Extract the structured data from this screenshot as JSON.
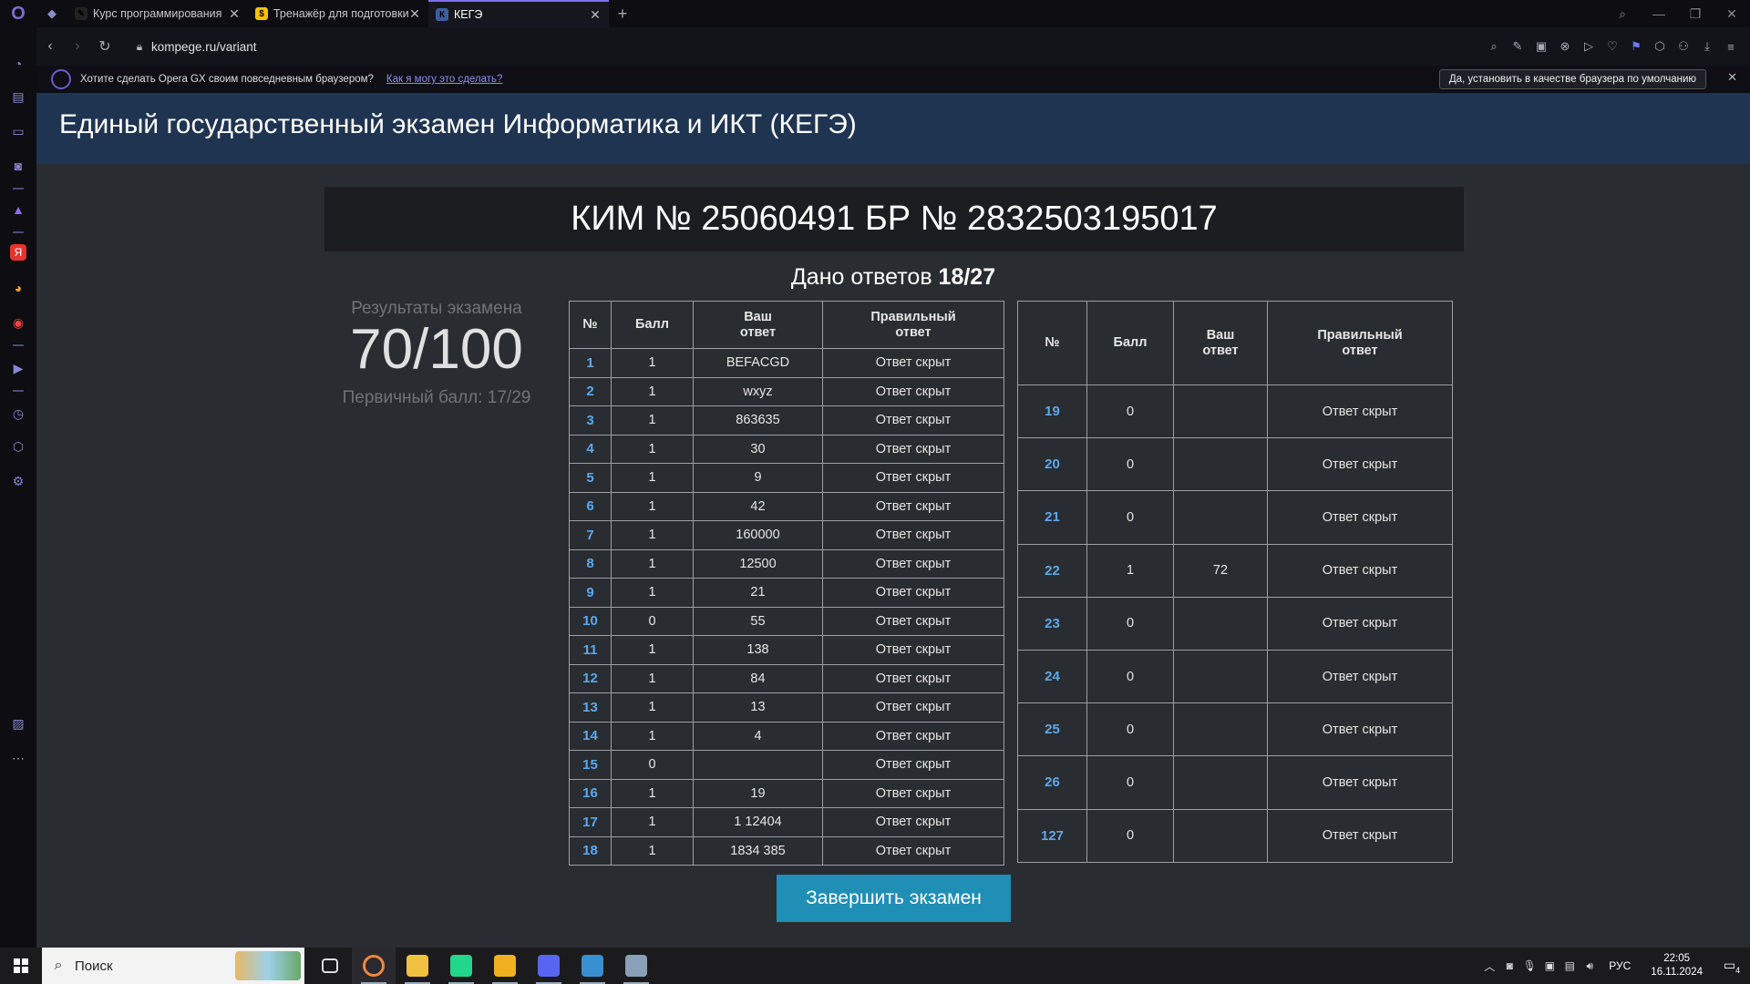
{
  "browser": {
    "tabs": [
      {
        "title": "Курс программирования",
        "active": false,
        "fav_color": "#222222",
        "fav_glyph": "✎"
      },
      {
        "title": "Тренажёр для подготовки",
        "active": false,
        "fav_color": "#f2c200",
        "fav_glyph": "$"
      },
      {
        "title": "КЕГЭ",
        "active": true,
        "fav_color": "#3a5fa0",
        "fav_glyph": "К"
      }
    ],
    "url": "kompege.ru/variant",
    "notification": {
      "question": "Хотите сделать Opera GX своим повседневным браузером?",
      "link": "Как я могу это сделать?",
      "button": "Да, установить в качестве браузера по умолчанию"
    }
  },
  "page": {
    "header_title": "Единый государственный экзамен Информатика и ИКТ (КЕГЭ)",
    "kim_title": "КИМ № 25060491 БР № 2832503195017",
    "answers_label": "Дано ответов ",
    "answers_value": "18/27",
    "results_label": "Результаты экзамена",
    "score": "70/100",
    "primary_score": "Первичный балл: 17/29",
    "finish_button": "Завершить экзамен"
  },
  "table_headers": {
    "num": "№",
    "score": "Балл",
    "your_answer_1": "Ваш",
    "your_answer_2": "ответ",
    "correct_1": "Правильный",
    "correct_2": "ответ"
  },
  "table_left": [
    {
      "n": "1",
      "score": "1",
      "answer": "BEFACGD",
      "correct": "Ответ скрыт"
    },
    {
      "n": "2",
      "score": "1",
      "answer": "wxyz",
      "correct": "Ответ скрыт"
    },
    {
      "n": "3",
      "score": "1",
      "answer": "863635",
      "correct": "Ответ скрыт"
    },
    {
      "n": "4",
      "score": "1",
      "answer": "30",
      "correct": "Ответ скрыт"
    },
    {
      "n": "5",
      "score": "1",
      "answer": "9",
      "correct": "Ответ скрыт"
    },
    {
      "n": "6",
      "score": "1",
      "answer": "42",
      "correct": "Ответ скрыт"
    },
    {
      "n": "7",
      "score": "1",
      "answer": "160000",
      "correct": "Ответ скрыт"
    },
    {
      "n": "8",
      "score": "1",
      "answer": "12500",
      "correct": "Ответ скрыт"
    },
    {
      "n": "9",
      "score": "1",
      "answer": "21",
      "correct": "Ответ скрыт"
    },
    {
      "n": "10",
      "score": "0",
      "answer": "55",
      "correct": "Ответ скрыт"
    },
    {
      "n": "11",
      "score": "1",
      "answer": "138",
      "correct": "Ответ скрыт"
    },
    {
      "n": "12",
      "score": "1",
      "answer": "84",
      "correct": "Ответ скрыт"
    },
    {
      "n": "13",
      "score": "1",
      "answer": "13",
      "correct": "Ответ скрыт"
    },
    {
      "n": "14",
      "score": "1",
      "answer": "4",
      "correct": "Ответ скрыт"
    },
    {
      "n": "15",
      "score": "0",
      "answer": "",
      "correct": "Ответ скрыт"
    },
    {
      "n": "16",
      "score": "1",
      "answer": "19",
      "correct": "Ответ скрыт"
    },
    {
      "n": "17",
      "score": "1",
      "answer": "1 12404",
      "correct": "Ответ скрыт"
    },
    {
      "n": "18",
      "score": "1",
      "answer": "1834 385",
      "correct": "Ответ скрыт"
    }
  ],
  "table_right": [
    {
      "n": "19",
      "score": "0",
      "answer": "",
      "correct": "Ответ скрыт"
    },
    {
      "n": "20",
      "score": "0",
      "answer": "",
      "correct": "Ответ скрыт"
    },
    {
      "n": "21",
      "score": "0",
      "answer": "",
      "correct": "Ответ скрыт"
    },
    {
      "n": "22",
      "score": "1",
      "answer": "72",
      "correct": "Ответ скрыт"
    },
    {
      "n": "23",
      "score": "0",
      "answer": "",
      "correct": "Ответ скрыт"
    },
    {
      "n": "24",
      "score": "0",
      "answer": "",
      "correct": "Ответ скрыт"
    },
    {
      "n": "25",
      "score": "0",
      "answer": "",
      "correct": "Ответ скрыт"
    },
    {
      "n": "26",
      "score": "0",
      "answer": "",
      "correct": "Ответ скрыт"
    },
    {
      "n": "127",
      "score": "0",
      "answer": "",
      "correct": "Ответ скрыт"
    }
  ],
  "taskbar": {
    "search_placeholder": "Поиск",
    "apps": [
      {
        "name": "task-view",
        "color": "#1b1b1e",
        "active": false
      },
      {
        "name": "opera-gx",
        "color": "#d0233a",
        "active": true
      },
      {
        "name": "file-explorer",
        "color": "#f0c040",
        "active": false
      },
      {
        "name": "pycharm",
        "color": "#21d789",
        "active": false
      },
      {
        "name": "sun-app",
        "color": "#f0b020",
        "active": false
      },
      {
        "name": "discord",
        "color": "#5865f2",
        "active": false
      },
      {
        "name": "notes-app",
        "color": "#3a8fd0",
        "active": false
      },
      {
        "name": "paint-app",
        "color": "#8aa0b8",
        "active": false
      }
    ],
    "lang": "РУС",
    "time": "22:05",
    "date": "16.11.2024",
    "notif_count": "4"
  },
  "colors": {
    "header_bg": "#1f3450",
    "page_bg": "#292c30",
    "accent_blue": "#5ba9ee",
    "button_bg": "#1f8fb5"
  }
}
